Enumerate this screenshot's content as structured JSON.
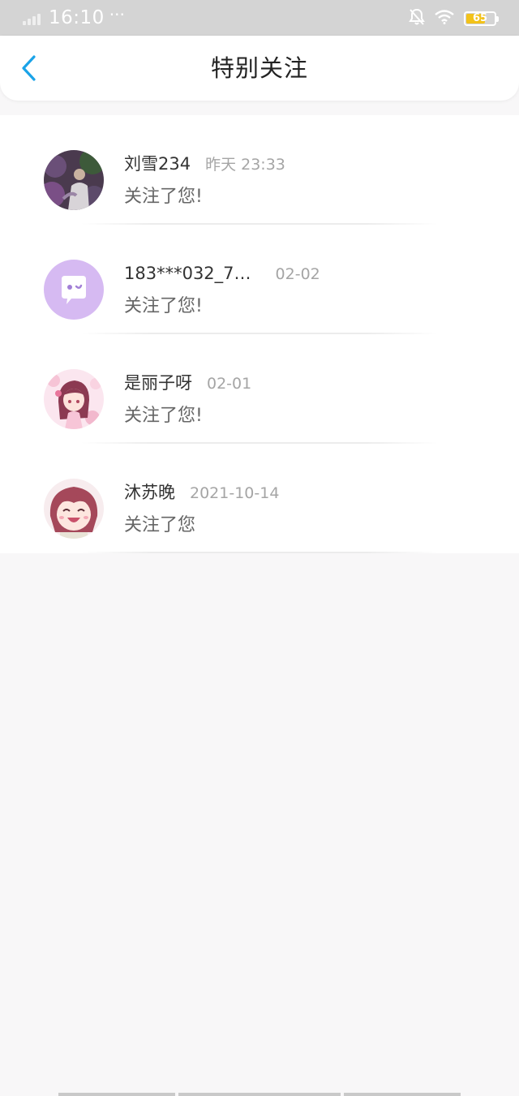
{
  "status_bar": {
    "time": "16:10",
    "more": "···",
    "battery_level": "65",
    "battery_color": "#f2c21a"
  },
  "nav": {
    "title": "特别关注",
    "back_icon": "chevron-left-icon",
    "accent_color": "#1aa3e8"
  },
  "items": [
    {
      "name": "刘雪234",
      "time": "昨天 23:33",
      "message": "关注了您!",
      "avatar": "photo-avatar"
    },
    {
      "name": "183***032_7…",
      "time": "02-02",
      "message": "关注了您!",
      "avatar": "default-chat-avatar"
    },
    {
      "name": "是丽子呀",
      "time": "02-01",
      "message": "关注了您!",
      "avatar": "anime-girl-avatar"
    },
    {
      "name": "沐苏晚",
      "time": "2021-10-14",
      "message": "关注了您",
      "avatar": "anime-smile-avatar"
    }
  ]
}
